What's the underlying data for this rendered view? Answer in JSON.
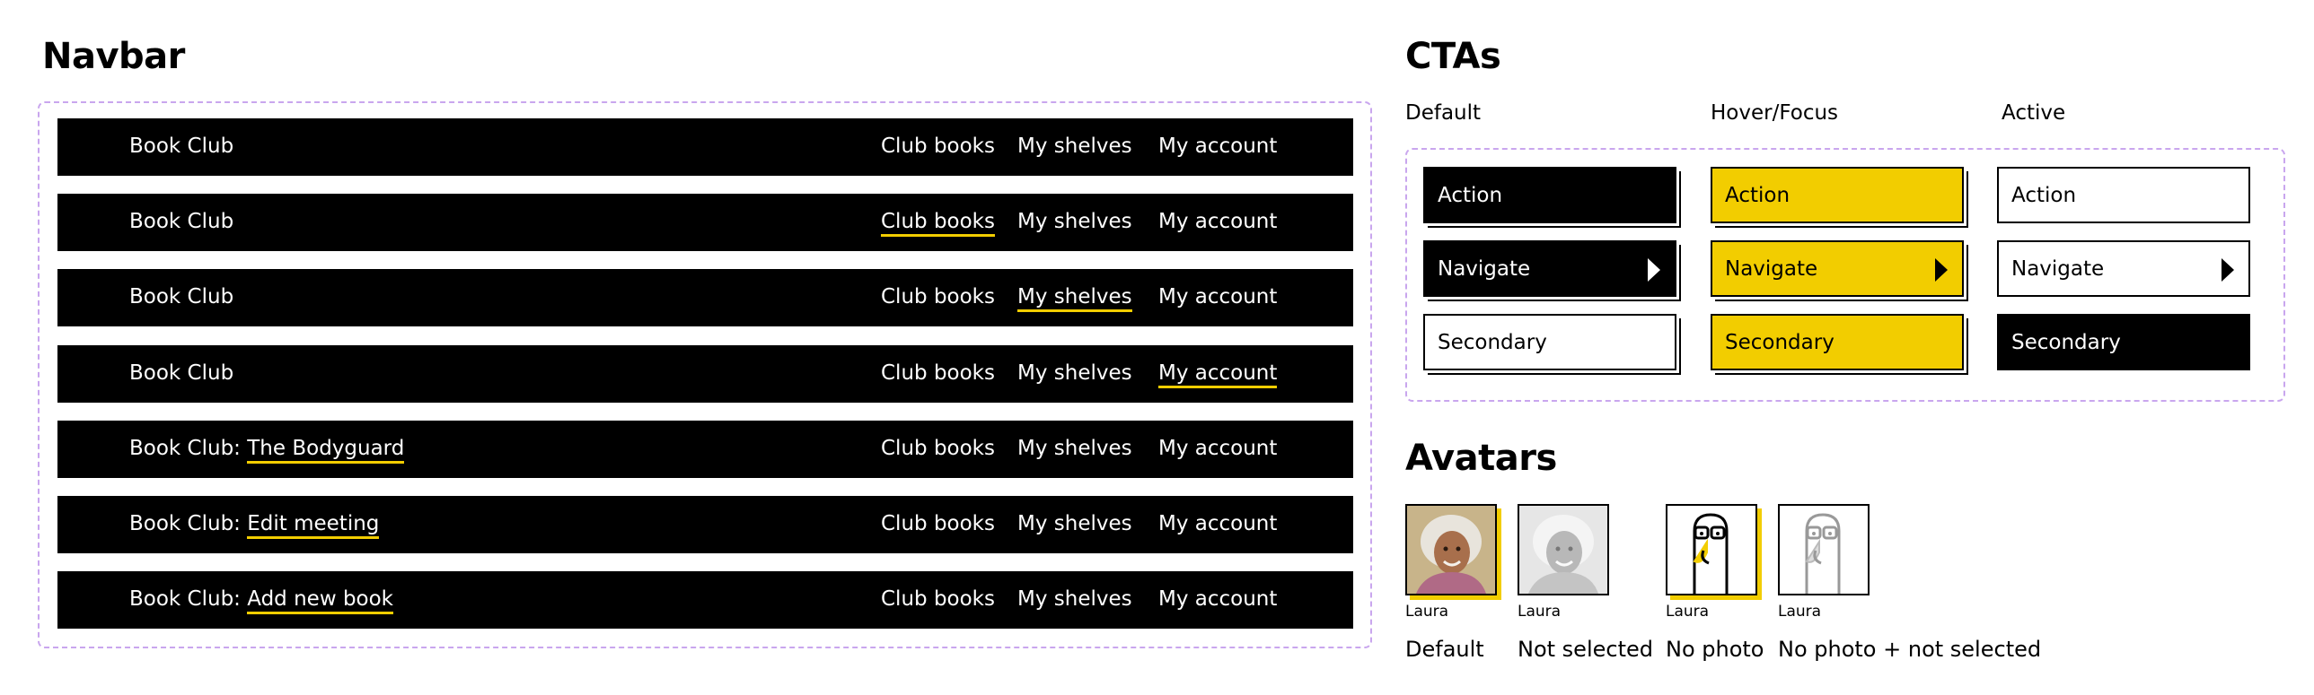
{
  "navbar": {
    "title": "Navbar",
    "links": [
      "Club books",
      "My shelves",
      "My account"
    ],
    "brand": "Book Club",
    "rows": [
      {
        "brand": "Book Club",
        "sub": "",
        "active": -1
      },
      {
        "brand": "Book Club",
        "sub": "",
        "active": 0
      },
      {
        "brand": "Book Club",
        "sub": "",
        "active": 1
      },
      {
        "brand": "Book Club",
        "sub": "",
        "active": 2
      },
      {
        "brand": "Book Club:",
        "sub": "The Bodyguard",
        "active": -1
      },
      {
        "brand": "Book Club:",
        "sub": "Edit meeting",
        "active": -1
      },
      {
        "brand": "Book Club:",
        "sub": "Add new book",
        "active": -1
      }
    ],
    "accent_color": "#f2cd00",
    "bar_color": "#000000"
  },
  "ctas": {
    "title": "CTAs",
    "states": [
      "Default",
      "Hover/Focus",
      "Active"
    ],
    "buttons": [
      "Action",
      "Navigate",
      "Secondary"
    ],
    "hover_color": "#f2cd00",
    "frame_color": "#c9a6ee"
  },
  "avatars": {
    "title": "Avatars",
    "items": [
      {
        "name": "Laura",
        "caption": "Default",
        "icon": "photo-avatar"
      },
      {
        "name": "Laura",
        "caption": "Not selected",
        "icon": "photo-avatar-grayscale"
      },
      {
        "name": "Laura",
        "caption": "No photo",
        "icon": "bird-with-glasses-avatar"
      },
      {
        "name": "Laura",
        "caption": "No photo + not selected",
        "icon": "bird-with-glasses-avatar-grayscale"
      }
    ]
  }
}
